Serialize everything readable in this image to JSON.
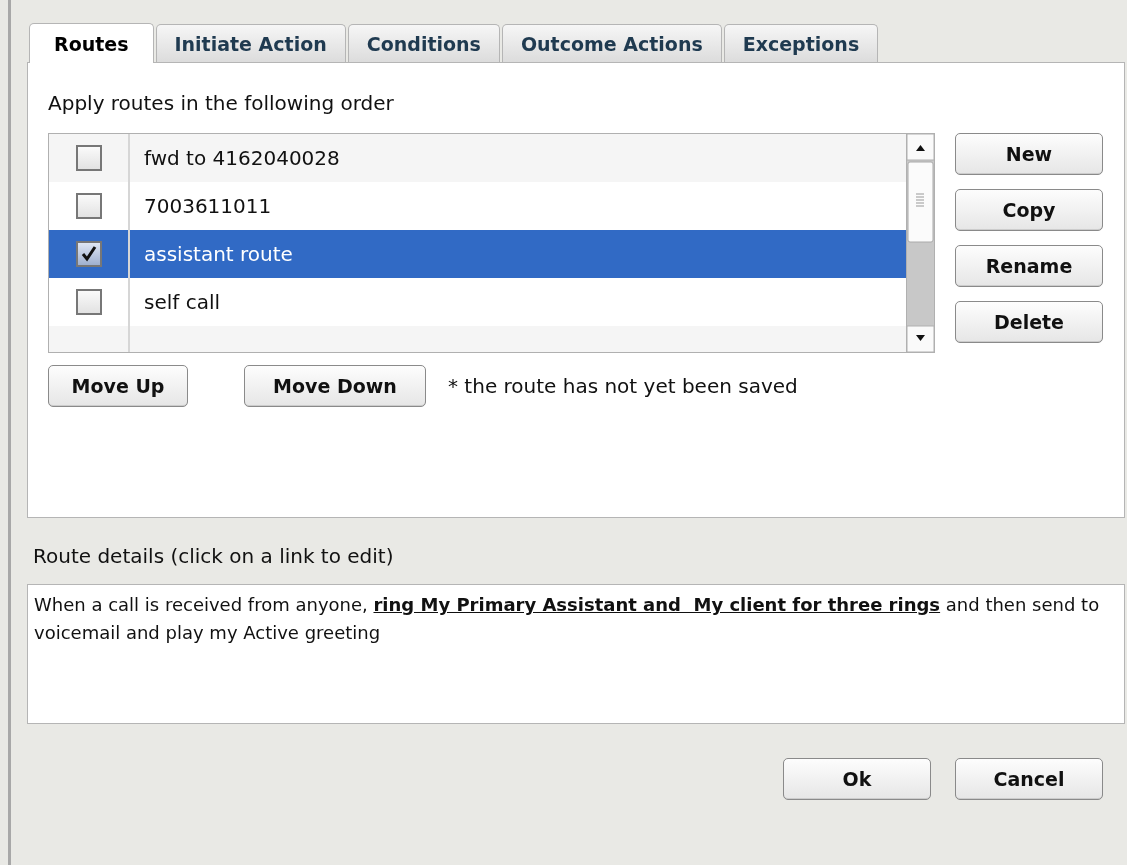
{
  "tabs": [
    {
      "label": "Routes",
      "selected": true
    },
    {
      "label": "Initiate Action",
      "selected": false
    },
    {
      "label": "Conditions",
      "selected": false
    },
    {
      "label": "Outcome Actions",
      "selected": false
    },
    {
      "label": "Exceptions",
      "selected": false
    }
  ],
  "routes_heading": "Apply routes in the following order",
  "routes": [
    {
      "name": "fwd to 4162040028",
      "checked": false,
      "selected": false
    },
    {
      "name": "7003611011",
      "checked": false,
      "selected": false
    },
    {
      "name": "assistant route",
      "checked": true,
      "selected": true
    },
    {
      "name": "self call",
      "checked": false,
      "selected": false
    }
  ],
  "side_buttons": [
    "New",
    "Copy",
    "Rename",
    "Delete"
  ],
  "move_buttons": [
    "Move Up",
    "Move Down"
  ],
  "unsaved_note": "* the route has not yet been saved",
  "details_label": "Route details (click on a link to edit)",
  "details": {
    "prefix": "When a call is received from anyone, ",
    "link": "ring My Primary Assistant and  My client for three rings",
    "suffix": " and then send to voicemail and play my Active greeting"
  },
  "dialog_buttons": [
    "Ok",
    "Cancel"
  ]
}
